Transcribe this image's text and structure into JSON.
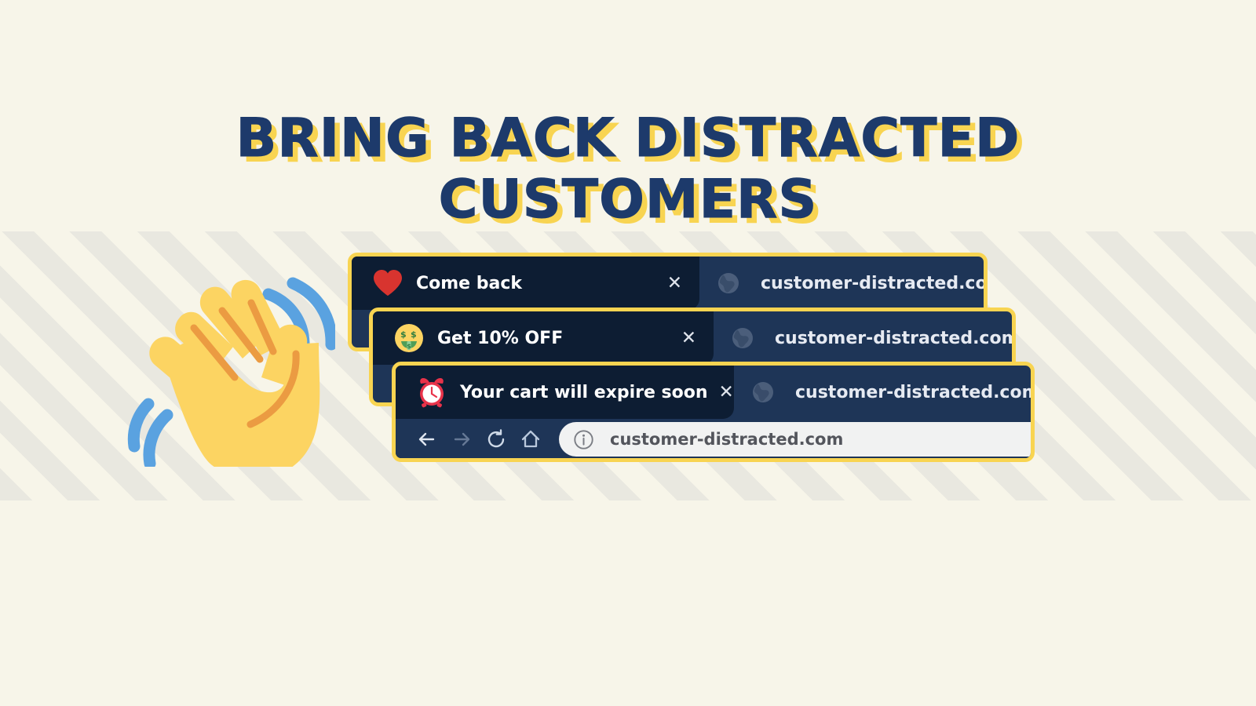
{
  "page": {
    "headline": "BRING BACK DISTRACTED\nCUSTOMERS",
    "background_color": "#f7f5e9",
    "accent_yellow": "#f8d451",
    "navy": "#1d3a6b"
  },
  "decoration": {
    "waving_hand_icon": "waving-hand-emoji",
    "stripe_band_colors": [
      "#e9e8e0",
      "#f7f5e9"
    ]
  },
  "windows": [
    {
      "emoji_name": "red-heart-emoji",
      "tab_title": "Come back",
      "close_label": "✕",
      "domain": "customer-distracted.com",
      "globe_icon": "globe-icon"
    },
    {
      "emoji_name": "money-mouth-face-emoji",
      "tab_title": "Get 10% OFF",
      "close_label": "✕",
      "domain": "customer-distracted.com",
      "globe_icon": "globe-icon"
    },
    {
      "emoji_name": "alarm-clock-emoji",
      "tab_title": "Your cart will expire soon",
      "close_label": "✕",
      "domain": "customer-distracted.com",
      "globe_icon": "globe-icon"
    }
  ],
  "toolbar": {
    "back_icon": "back-arrow-icon",
    "forward_icon": "forward-arrow-icon",
    "reload_icon": "reload-icon",
    "home_icon": "home-icon",
    "info_icon": "info-circle-icon",
    "url": "customer-distracted.com"
  }
}
